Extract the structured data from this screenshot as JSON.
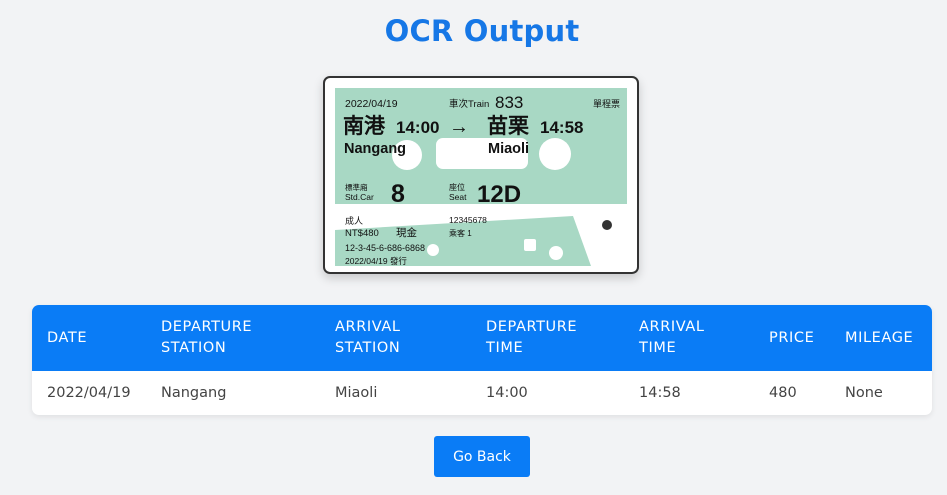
{
  "page": {
    "title": "OCR Output"
  },
  "ticket": {
    "date": "2022/04/19",
    "train_label": "車次Train",
    "train_no": "833",
    "ticket_type": "單程票",
    "from_zh": "南港",
    "from_time": "14:00",
    "arrow": "→",
    "to_zh": "苗栗",
    "to_time": "14:58",
    "from_en": "Nangang",
    "to_en": "Miaoli",
    "car_label_zh": "標準廂",
    "car_label_en": "Std.Car",
    "car_no": "8",
    "seat_label_zh": "座位",
    "seat_label_en": "Seat",
    "seat_no": "12D",
    "passenger": "成人",
    "price": "NT$480",
    "payment": "現金",
    "ticket_no": "12345678",
    "passenger_count": "乘客 1",
    "serial": "12-3-45-6-686-6868",
    "issued": "2022/04/19 發行"
  },
  "table": {
    "headers": {
      "date": "DATE",
      "dep_station_1": "DEPARTURE",
      "dep_station_2": "STATION",
      "arr_station_1": "ARRIVAL",
      "arr_station_2": "STATION",
      "dep_time_1": "DEPARTURE",
      "dep_time_2": "TIME",
      "arr_time_1": "ARRIVAL",
      "arr_time_2": "TIME",
      "price": "PRICE",
      "mileage": "MILEAGE"
    },
    "row": {
      "date": "2022/04/19",
      "dep_station": "Nangang",
      "arr_station": "Miaoli",
      "dep_time": "14:00",
      "arr_time": "14:58",
      "price": "480",
      "mileage": "None"
    }
  },
  "buttons": {
    "go_back": "Go Back"
  },
  "colors": {
    "accent": "#0a7cf6",
    "title": "#1677e6",
    "ticket_green": "#a8d8c4"
  }
}
